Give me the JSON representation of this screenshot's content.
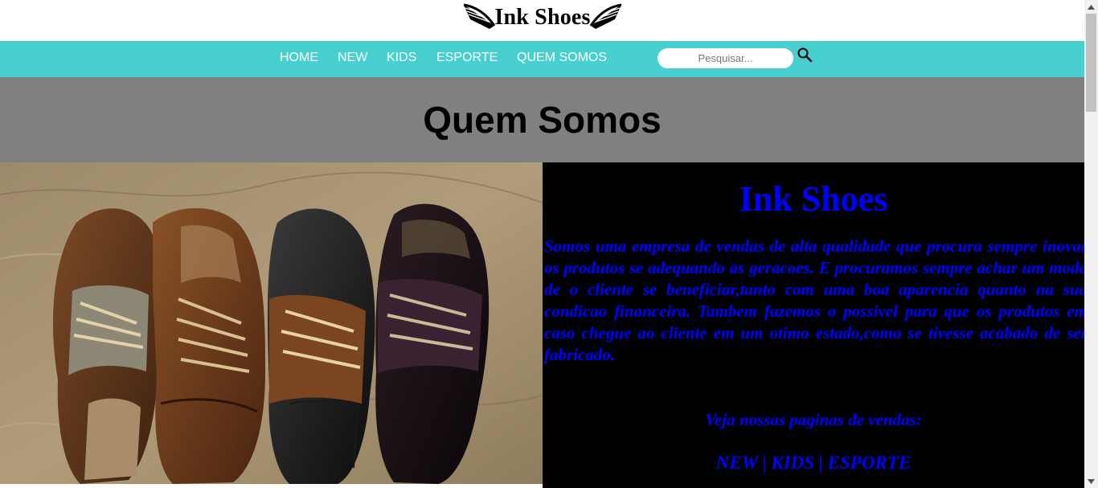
{
  "header": {
    "logo_text": "Ink Shoes"
  },
  "nav": {
    "items": [
      {
        "label": "HOME"
      },
      {
        "label": "NEW"
      },
      {
        "label": "KIDS"
      },
      {
        "label": "ESPORTE"
      },
      {
        "label": "QUEM SOMOS"
      }
    ],
    "search": {
      "placeholder": "Pesquisar..."
    }
  },
  "page": {
    "title": "Quem Somos"
  },
  "about": {
    "brand": "Ink Shoes",
    "description": "Somos uma empresa de vendas de alta qualidade que procura sempre inovar os produtos se adequando as geracoes. E procuramos sempre achar um modo de o cliente se beneficiar,tanto com uma boa aparencia quanto na sua condicao financeira. Tambem fazemos o possivel para que os produtos em caso chegue ao cliente em um otimo estado,como se tivesse acabado de ser fabricado.",
    "cta": "Veja nossas paginas de vendas:",
    "links": [
      "NEW",
      "KIDS",
      "ESPORTE"
    ],
    "separator": " | "
  },
  "colors": {
    "nav_bg": "#48cfcf",
    "band_bg": "#808080",
    "info_bg": "#000000",
    "info_text": "#0000ff"
  }
}
